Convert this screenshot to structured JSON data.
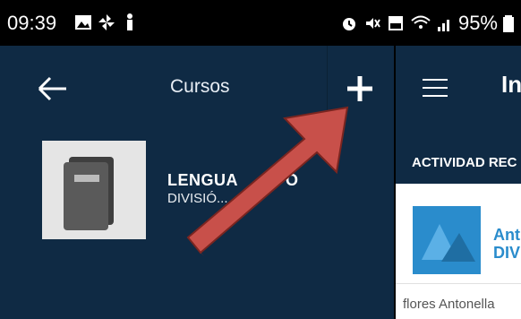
{
  "status_bar": {
    "time": "09:39",
    "battery": "95%"
  },
  "left_panel": {
    "title": "Cursos",
    "course": {
      "name": "LENGUA ... O",
      "name_visible_left": "LENGUA",
      "name_visible_right": "O",
      "subtitle": "DIVISIÓ..."
    }
  },
  "right_panel": {
    "title": "In",
    "tab": "ACTIVIDAD REC",
    "card": {
      "title": "Ant",
      "subtitle": "DIV"
    },
    "author": "flores Antonella"
  },
  "colors": {
    "header_bg": "#0f2a44",
    "accent": "#2a8ccc",
    "arrow": "#c8504a"
  },
  "icons": {
    "back": "arrow-left-icon",
    "add": "plus-icon",
    "menu": "hamburger-icon"
  }
}
